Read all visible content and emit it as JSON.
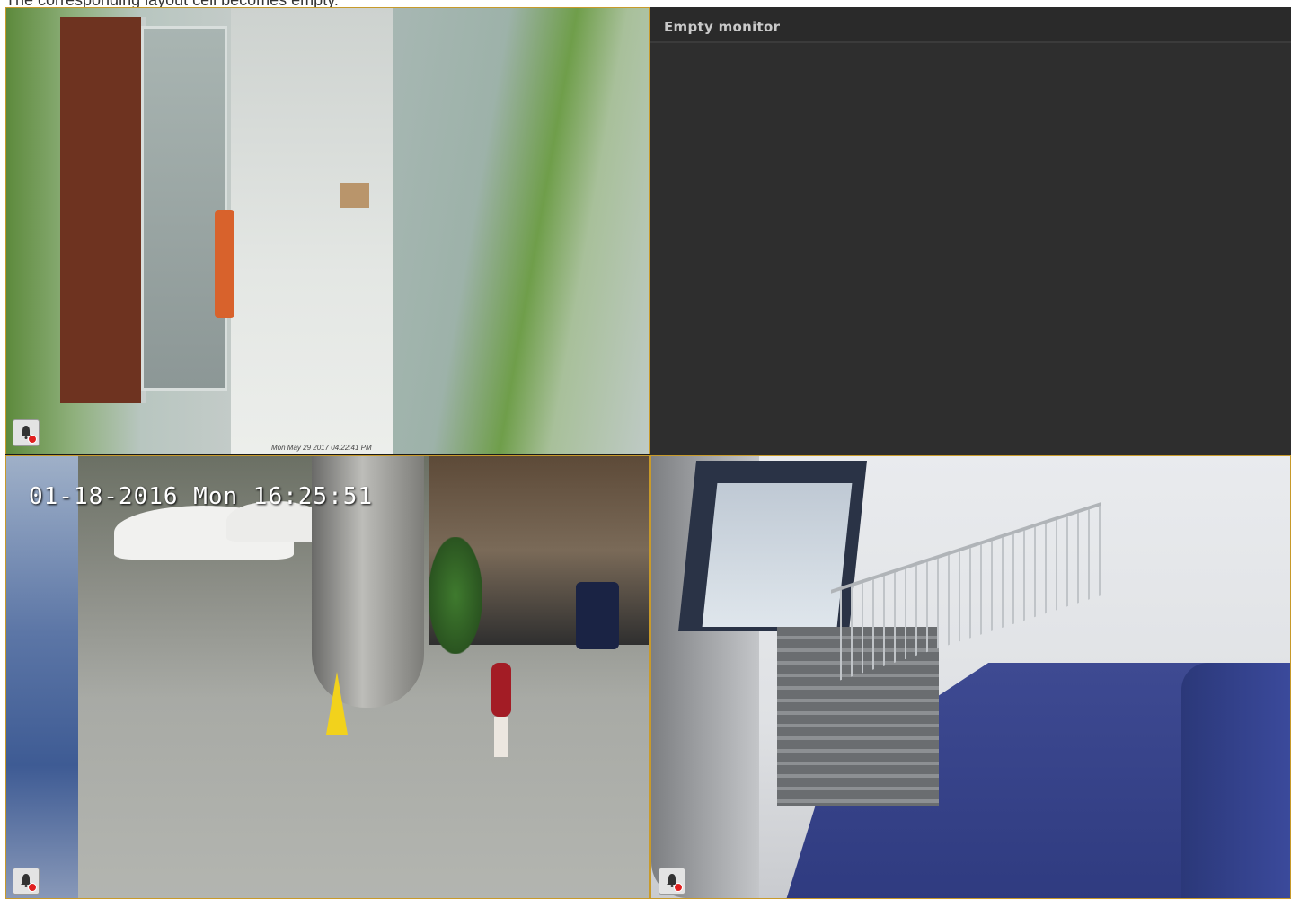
{
  "caption": "The corresponding layout cell becomes empty.",
  "cells": {
    "cam1": {
      "timestamp": "Mon May 29 2017 04:22:41 PM",
      "alarm_icon": "bell-icon"
    },
    "empty": {
      "title": "Empty monitor"
    },
    "cam3": {
      "timestamp": "01-18-2016 Mon 16:25:51",
      "alarm_icon": "bell-icon"
    },
    "cam4": {
      "alarm_icon": "bell-icon"
    }
  },
  "colors": {
    "active_border": "#c89a2a",
    "empty_bg": "#2e2e2e",
    "alarm_dot": "#e02020"
  }
}
